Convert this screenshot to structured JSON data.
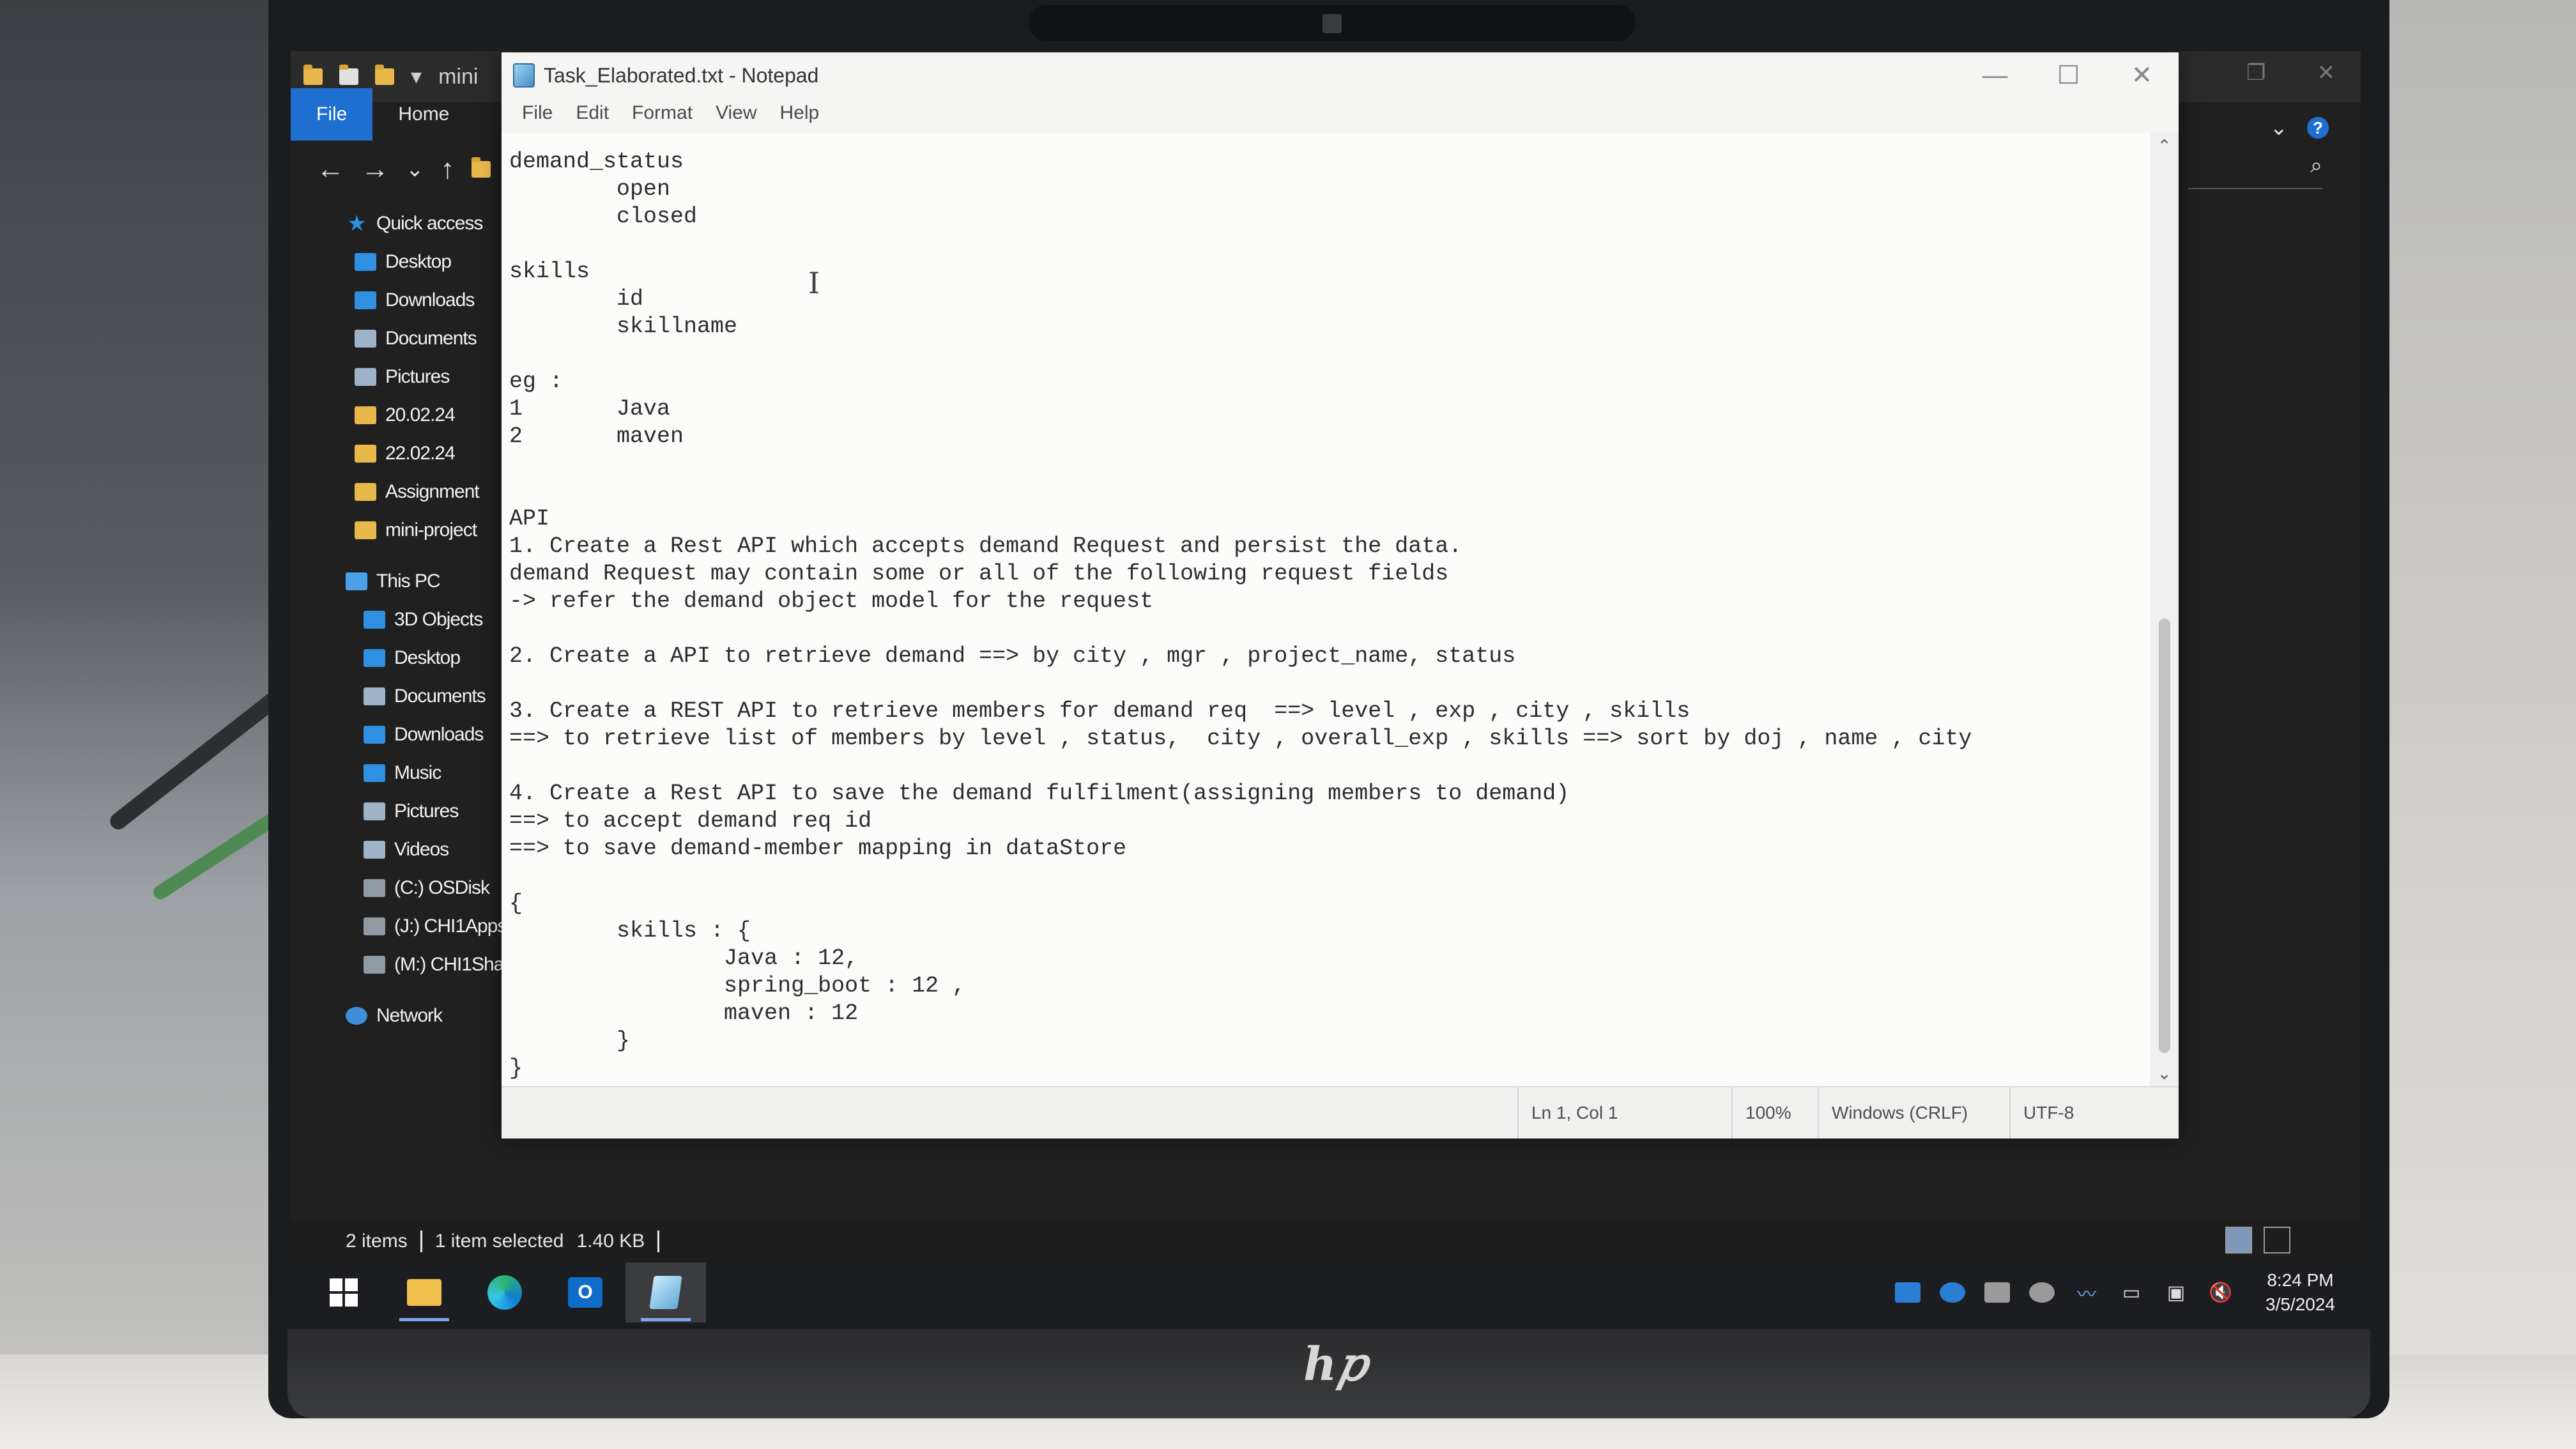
{
  "explorer": {
    "title_fragment": "mini",
    "ribbon_tabs": [
      "File",
      "Home"
    ],
    "quick_access": [
      {
        "label": "Quick access",
        "icon": "star-icon"
      },
      {
        "label": "Desktop",
        "icon": "desktop-icon"
      },
      {
        "label": "Downloads",
        "icon": "download-icon"
      },
      {
        "label": "Documents",
        "icon": "documents-icon"
      },
      {
        "label": "Pictures",
        "icon": "pictures-icon"
      },
      {
        "label": "20.02.24",
        "icon": "folder-icon"
      },
      {
        "label": "22.02.24",
        "icon": "folder-icon"
      },
      {
        "label": "Assignment",
        "icon": "folder-icon"
      },
      {
        "label": "mini-project",
        "icon": "folder-icon"
      }
    ],
    "this_pc": [
      {
        "label": "This PC",
        "icon": "computer-icon"
      },
      {
        "label": "3D Objects",
        "icon": "3d-objects-icon"
      },
      {
        "label": "Desktop",
        "icon": "desktop-icon"
      },
      {
        "label": "Documents",
        "icon": "documents-icon"
      },
      {
        "label": "Downloads",
        "icon": "download-icon"
      },
      {
        "label": "Music",
        "icon": "music-icon"
      },
      {
        "label": "Pictures",
        "icon": "pictures-icon"
      },
      {
        "label": "Videos",
        "icon": "videos-icon"
      },
      {
        "label": "(C:) OSDisk",
        "icon": "drive-icon"
      },
      {
        "label": "(J:) CHI1Apps",
        "icon": "network-drive-icon"
      },
      {
        "label": "(M:) CHI1Sha",
        "icon": "network-drive-icon"
      }
    ],
    "network_label": "Network",
    "status": {
      "items": "2 items",
      "selected": "1 item selected",
      "size": "1.40 KB"
    }
  },
  "notepad": {
    "title": "Task_Elaborated.txt - Notepad",
    "menu": [
      "File",
      "Edit",
      "Format",
      "View",
      "Help"
    ],
    "content": "demand_status\n        open\n        closed\n\nskills\n        id\n        skillname\n\neg :\n1       Java\n2       maven\n\n\nAPI\n1. Create a Rest API which accepts demand Request and persist the data.\ndemand Request may contain some or all of the following request fields\n-> refer the demand object model for the request\n\n2. Create a API to retrieve demand ==> by city , mgr , project_name, status\n\n3. Create a REST API to retrieve members for demand req  ==> level , exp , city , skills\n==> to retrieve list of members by level , status,  city , overall_exp , skills ==> sort by doj , name , city\n\n4. Create a Rest API to save the demand fulfilment(assigning members to demand)\n==> to accept demand req id\n==> to save demand-member mapping in dataStore\n\n{\n        skills : {\n                Java : 12,\n                spring_boot : 12 ,\n                maven : 12\n        }\n}",
    "status": {
      "position": "Ln 1, Col 1",
      "zoom": "100%",
      "line_ending": "Windows (CRLF)",
      "encoding": "UTF-8"
    }
  },
  "taskbar": {
    "apps": [
      "start-icon",
      "file-explorer-icon",
      "edge-icon",
      "outlook-icon",
      "notepad-icon"
    ],
    "time": "8:24 PM",
    "date": "3/5/2024"
  },
  "colors": {
    "accent": "#1f6fd1",
    "explorer_bg": "#202020",
    "notepad_bg": "#fbfbfa"
  }
}
